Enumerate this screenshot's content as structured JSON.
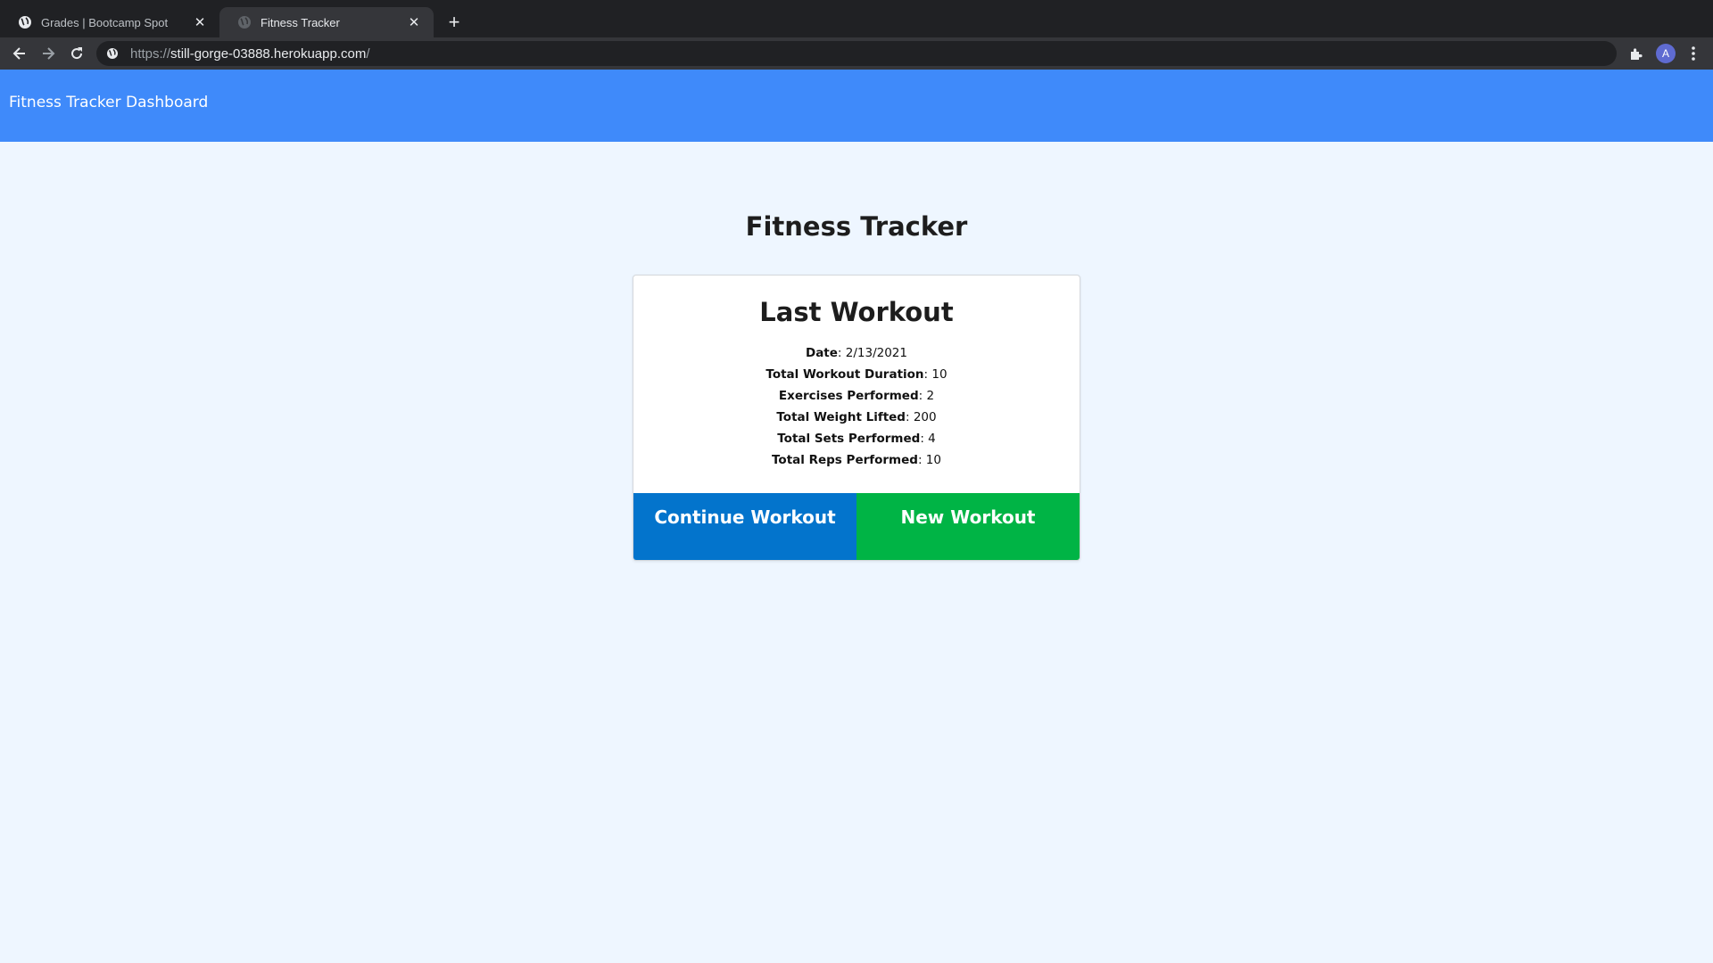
{
  "browser": {
    "tabs": [
      {
        "title": "Grades | Bootcamp Spot",
        "active": false
      },
      {
        "title": "Fitness Tracker",
        "active": true
      }
    ],
    "url_scheme": "https://",
    "url_host": "still-gorge-03888.herokuapp.com",
    "url_path": "/",
    "avatar_letter": "A"
  },
  "navbar": {
    "brand": "Fitness Tracker Dashboard"
  },
  "main": {
    "title": "Fitness Tracker",
    "card": {
      "title": "Last Workout",
      "stats": [
        {
          "label": "Date",
          "value": "2/13/2021"
        },
        {
          "label": "Total Workout Duration",
          "value": "10"
        },
        {
          "label": "Exercises Performed",
          "value": "2"
        },
        {
          "label": "Total Weight Lifted",
          "value": "200"
        },
        {
          "label": "Total Sets Performed",
          "value": "4"
        },
        {
          "label": "Total Reps Performed",
          "value": "10"
        }
      ],
      "continue_label": "Continue Workout",
      "new_label": "New Workout"
    }
  },
  "colors": {
    "navbar": "#3f8afa",
    "page_bg": "#eef6ff",
    "continue_button": "#0374cc",
    "new_button": "#00b445"
  }
}
